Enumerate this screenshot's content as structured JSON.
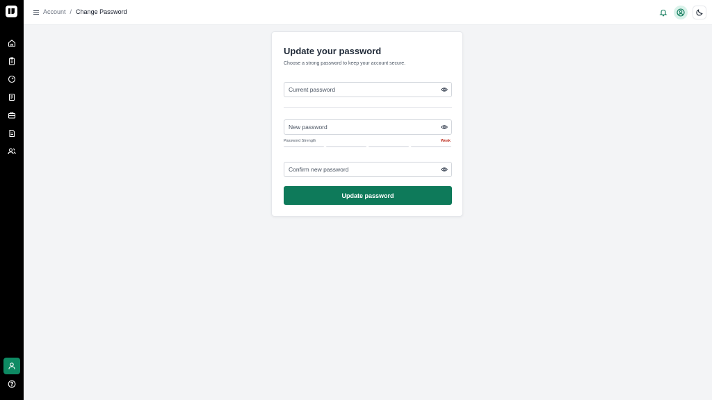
{
  "sidebar": {
    "logo": "logo-icon",
    "items": [
      {
        "icon": "home-icon"
      },
      {
        "icon": "clipboard-icon"
      },
      {
        "icon": "gauge-icon"
      },
      {
        "icon": "document-icon"
      },
      {
        "icon": "briefcase-icon"
      },
      {
        "icon": "file-text-icon"
      },
      {
        "icon": "users-icon"
      }
    ],
    "bottom": [
      {
        "icon": "user-icon",
        "active": true
      },
      {
        "icon": "help-icon"
      }
    ]
  },
  "header": {
    "menu_icon": "menu-icon",
    "breadcrumb": {
      "parent": "Account",
      "separator": "/",
      "current": "Change Password"
    },
    "actions": [
      "bell-icon",
      "user-circle-icon",
      "moon-icon"
    ]
  },
  "form": {
    "title": "Update your password",
    "subtitle": "Choose a strong password to keep your account secure.",
    "current_password": {
      "placeholder": "Current password",
      "value": ""
    },
    "new_password": {
      "placeholder": "New password",
      "value": ""
    },
    "strength": {
      "label": "Password Strength",
      "value": "Weak",
      "level": 0,
      "segments": 4
    },
    "confirm_password": {
      "placeholder": "Confirm new password",
      "value": ""
    },
    "submit_label": "Update password"
  },
  "colors": {
    "accent": "#0e7a5a",
    "sidebar_bg": "#000000",
    "page_bg": "#f3f4f6",
    "weak": "#c0392b"
  }
}
